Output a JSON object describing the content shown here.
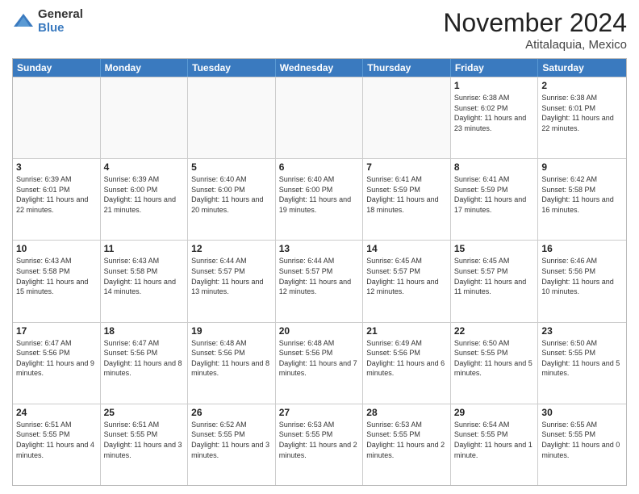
{
  "header": {
    "logo_general": "General",
    "logo_blue": "Blue",
    "month_title": "November 2024",
    "location": "Atitalaquia, Mexico"
  },
  "calendar": {
    "days_of_week": [
      "Sunday",
      "Monday",
      "Tuesday",
      "Wednesday",
      "Thursday",
      "Friday",
      "Saturday"
    ],
    "weeks": [
      [
        {
          "day": "",
          "sunrise": "",
          "sunset": "",
          "daylight": "",
          "empty": true
        },
        {
          "day": "",
          "sunrise": "",
          "sunset": "",
          "daylight": "",
          "empty": true
        },
        {
          "day": "",
          "sunrise": "",
          "sunset": "",
          "daylight": "",
          "empty": true
        },
        {
          "day": "",
          "sunrise": "",
          "sunset": "",
          "daylight": "",
          "empty": true
        },
        {
          "day": "",
          "sunrise": "",
          "sunset": "",
          "daylight": "",
          "empty": true
        },
        {
          "day": "1",
          "sunrise": "Sunrise: 6:38 AM",
          "sunset": "Sunset: 6:02 PM",
          "daylight": "Daylight: 11 hours and 23 minutes.",
          "empty": false
        },
        {
          "day": "2",
          "sunrise": "Sunrise: 6:38 AM",
          "sunset": "Sunset: 6:01 PM",
          "daylight": "Daylight: 11 hours and 22 minutes.",
          "empty": false
        }
      ],
      [
        {
          "day": "3",
          "sunrise": "Sunrise: 6:39 AM",
          "sunset": "Sunset: 6:01 PM",
          "daylight": "Daylight: 11 hours and 22 minutes.",
          "empty": false
        },
        {
          "day": "4",
          "sunrise": "Sunrise: 6:39 AM",
          "sunset": "Sunset: 6:00 PM",
          "daylight": "Daylight: 11 hours and 21 minutes.",
          "empty": false
        },
        {
          "day": "5",
          "sunrise": "Sunrise: 6:40 AM",
          "sunset": "Sunset: 6:00 PM",
          "daylight": "Daylight: 11 hours and 20 minutes.",
          "empty": false
        },
        {
          "day": "6",
          "sunrise": "Sunrise: 6:40 AM",
          "sunset": "Sunset: 6:00 PM",
          "daylight": "Daylight: 11 hours and 19 minutes.",
          "empty": false
        },
        {
          "day": "7",
          "sunrise": "Sunrise: 6:41 AM",
          "sunset": "Sunset: 5:59 PM",
          "daylight": "Daylight: 11 hours and 18 minutes.",
          "empty": false
        },
        {
          "day": "8",
          "sunrise": "Sunrise: 6:41 AM",
          "sunset": "Sunset: 5:59 PM",
          "daylight": "Daylight: 11 hours and 17 minutes.",
          "empty": false
        },
        {
          "day": "9",
          "sunrise": "Sunrise: 6:42 AM",
          "sunset": "Sunset: 5:58 PM",
          "daylight": "Daylight: 11 hours and 16 minutes.",
          "empty": false
        }
      ],
      [
        {
          "day": "10",
          "sunrise": "Sunrise: 6:43 AM",
          "sunset": "Sunset: 5:58 PM",
          "daylight": "Daylight: 11 hours and 15 minutes.",
          "empty": false
        },
        {
          "day": "11",
          "sunrise": "Sunrise: 6:43 AM",
          "sunset": "Sunset: 5:58 PM",
          "daylight": "Daylight: 11 hours and 14 minutes.",
          "empty": false
        },
        {
          "day": "12",
          "sunrise": "Sunrise: 6:44 AM",
          "sunset": "Sunset: 5:57 PM",
          "daylight": "Daylight: 11 hours and 13 minutes.",
          "empty": false
        },
        {
          "day": "13",
          "sunrise": "Sunrise: 6:44 AM",
          "sunset": "Sunset: 5:57 PM",
          "daylight": "Daylight: 11 hours and 12 minutes.",
          "empty": false
        },
        {
          "day": "14",
          "sunrise": "Sunrise: 6:45 AM",
          "sunset": "Sunset: 5:57 PM",
          "daylight": "Daylight: 11 hours and 12 minutes.",
          "empty": false
        },
        {
          "day": "15",
          "sunrise": "Sunrise: 6:45 AM",
          "sunset": "Sunset: 5:57 PM",
          "daylight": "Daylight: 11 hours and 11 minutes.",
          "empty": false
        },
        {
          "day": "16",
          "sunrise": "Sunrise: 6:46 AM",
          "sunset": "Sunset: 5:56 PM",
          "daylight": "Daylight: 11 hours and 10 minutes.",
          "empty": false
        }
      ],
      [
        {
          "day": "17",
          "sunrise": "Sunrise: 6:47 AM",
          "sunset": "Sunset: 5:56 PM",
          "daylight": "Daylight: 11 hours and 9 minutes.",
          "empty": false
        },
        {
          "day": "18",
          "sunrise": "Sunrise: 6:47 AM",
          "sunset": "Sunset: 5:56 PM",
          "daylight": "Daylight: 11 hours and 8 minutes.",
          "empty": false
        },
        {
          "day": "19",
          "sunrise": "Sunrise: 6:48 AM",
          "sunset": "Sunset: 5:56 PM",
          "daylight": "Daylight: 11 hours and 8 minutes.",
          "empty": false
        },
        {
          "day": "20",
          "sunrise": "Sunrise: 6:48 AM",
          "sunset": "Sunset: 5:56 PM",
          "daylight": "Daylight: 11 hours and 7 minutes.",
          "empty": false
        },
        {
          "day": "21",
          "sunrise": "Sunrise: 6:49 AM",
          "sunset": "Sunset: 5:56 PM",
          "daylight": "Daylight: 11 hours and 6 minutes.",
          "empty": false
        },
        {
          "day": "22",
          "sunrise": "Sunrise: 6:50 AM",
          "sunset": "Sunset: 5:55 PM",
          "daylight": "Daylight: 11 hours and 5 minutes.",
          "empty": false
        },
        {
          "day": "23",
          "sunrise": "Sunrise: 6:50 AM",
          "sunset": "Sunset: 5:55 PM",
          "daylight": "Daylight: 11 hours and 5 minutes.",
          "empty": false
        }
      ],
      [
        {
          "day": "24",
          "sunrise": "Sunrise: 6:51 AM",
          "sunset": "Sunset: 5:55 PM",
          "daylight": "Daylight: 11 hours and 4 minutes.",
          "empty": false
        },
        {
          "day": "25",
          "sunrise": "Sunrise: 6:51 AM",
          "sunset": "Sunset: 5:55 PM",
          "daylight": "Daylight: 11 hours and 3 minutes.",
          "empty": false
        },
        {
          "day": "26",
          "sunrise": "Sunrise: 6:52 AM",
          "sunset": "Sunset: 5:55 PM",
          "daylight": "Daylight: 11 hours and 3 minutes.",
          "empty": false
        },
        {
          "day": "27",
          "sunrise": "Sunrise: 6:53 AM",
          "sunset": "Sunset: 5:55 PM",
          "daylight": "Daylight: 11 hours and 2 minutes.",
          "empty": false
        },
        {
          "day": "28",
          "sunrise": "Sunrise: 6:53 AM",
          "sunset": "Sunset: 5:55 PM",
          "daylight": "Daylight: 11 hours and 2 minutes.",
          "empty": false
        },
        {
          "day": "29",
          "sunrise": "Sunrise: 6:54 AM",
          "sunset": "Sunset: 5:55 PM",
          "daylight": "Daylight: 11 hours and 1 minute.",
          "empty": false
        },
        {
          "day": "30",
          "sunrise": "Sunrise: 6:55 AM",
          "sunset": "Sunset: 5:55 PM",
          "daylight": "Daylight: 11 hours and 0 minutes.",
          "empty": false
        }
      ]
    ]
  }
}
